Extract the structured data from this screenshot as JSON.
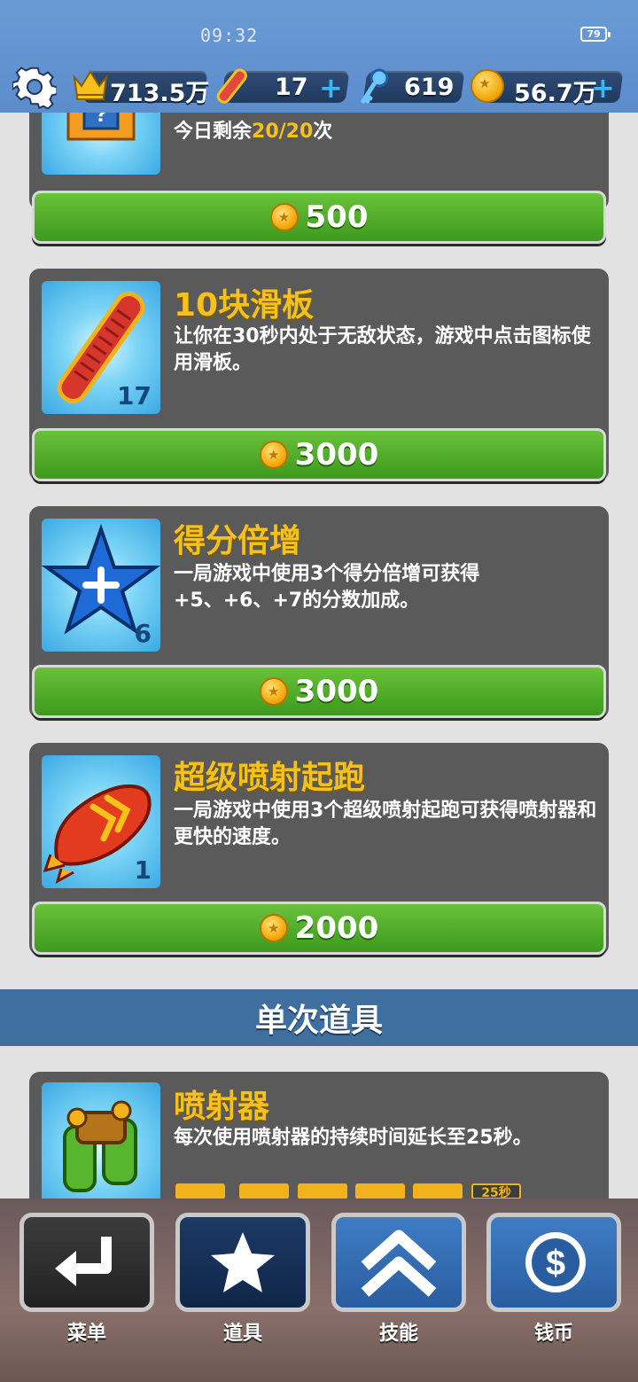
{
  "status": {
    "time": "09:32",
    "battery": "79"
  },
  "resources": {
    "score": "713.5万",
    "hoverboards": "17",
    "keys": "619",
    "coins": "56.7万",
    "plus": "+"
  },
  "items": [
    {
      "title": "",
      "desc_prefix": "今日剩余",
      "desc_highlight": "20/20",
      "desc_suffix": "次",
      "price": "500"
    },
    {
      "title": "10块滑板",
      "desc": "让你在30秒内处于无敌状态，游戏中点击图标使用滑板。",
      "count": "17",
      "price": "3000"
    },
    {
      "title": "得分倍增",
      "desc": "一局游戏中使用3个得分倍增可获得+5、+6、+7的分数加成。",
      "count": "6",
      "price": "3000"
    },
    {
      "title": "超级喷射起跑",
      "desc": "一局游戏中使用3个超级喷射起跑可获得喷射器和更快的速度。",
      "count": "1",
      "price": "2000"
    }
  ],
  "section": {
    "title": "单次道具"
  },
  "single_item": {
    "title": "喷射器",
    "desc": "每次使用喷射器的持续时间延长至25秒。",
    "upgrade_tag": "25秒"
  },
  "nav": [
    {
      "label": "菜单"
    },
    {
      "label": "道具"
    },
    {
      "label": "技能"
    },
    {
      "label": "钱币"
    }
  ],
  "colors": {
    "accent_yellow": "#f6c11b",
    "buy_green": "#4caf28",
    "header_blue": "#5b8ccc"
  }
}
